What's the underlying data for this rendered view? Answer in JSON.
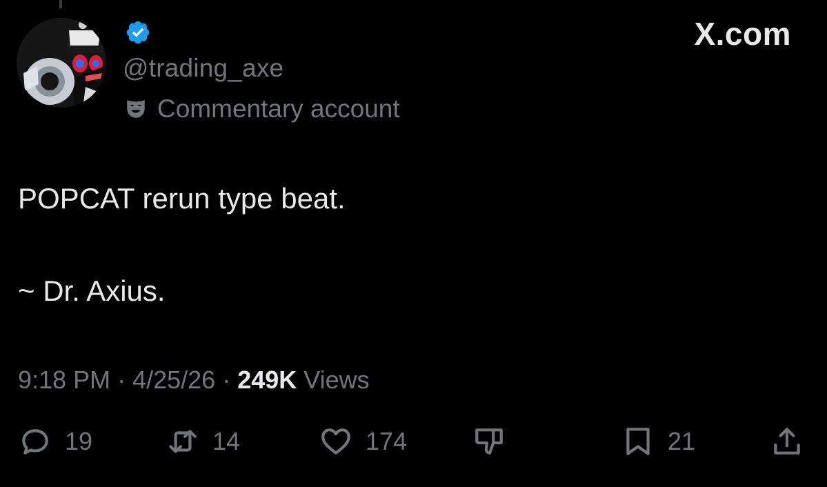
{
  "brand": {
    "site": "X.com"
  },
  "author": {
    "handle": "@trading_axe",
    "label": "Commentary account",
    "verified_color": "#1d9bf0"
  },
  "tweet": {
    "line1": "POPCAT rerun type beat.",
    "line2": "~ Dr. Axius."
  },
  "meta": {
    "time": "9:18 PM",
    "sep1": " · ",
    "date": "4/25/26",
    "sep2": " · ",
    "views_count": "249K",
    "views_label": " Views"
  },
  "actions": {
    "replies": "19",
    "reposts": "14",
    "likes": "174",
    "bookmarks": "21",
    "icons": [
      "reply-icon",
      "repost-icon",
      "like-icon",
      "dislike-icon",
      "bookmark-icon",
      "share-icon"
    ]
  },
  "colors": {
    "background": "#000000",
    "text": "#e7e9ea",
    "muted": "#71767b"
  }
}
